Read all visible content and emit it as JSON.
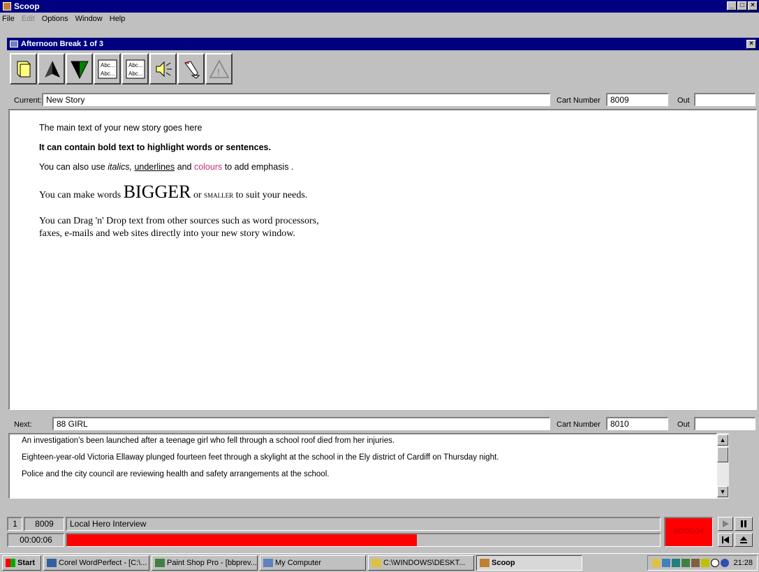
{
  "app": {
    "title": "Scoop",
    "icon": "scoop-app-icon"
  },
  "menu": [
    "File",
    "Edit",
    "Options",
    "Window",
    "Help"
  ],
  "child_window": {
    "title": "Afternoon Break 1 of 3"
  },
  "toolbar": {
    "buttons": [
      {
        "name": "open-book-icon"
      },
      {
        "name": "previous-story-icon"
      },
      {
        "name": "next-story-icon"
      },
      {
        "name": "text-style-icon",
        "text": [
          "Abc...",
          "Abc..."
        ]
      },
      {
        "name": "text-format-icon",
        "text": [
          "Abc...",
          "Abc..."
        ]
      },
      {
        "name": "speaker-icon"
      },
      {
        "name": "edit-pen-icon"
      },
      {
        "name": "warning-icon"
      }
    ]
  },
  "current": {
    "label": "Current:",
    "value": "New Story",
    "cart_label": "Cart Number",
    "cart_value": "8009",
    "out_label": "Out",
    "out_value": ""
  },
  "story": {
    "line1": "The main text of your new story goes here",
    "line2": "It can contain bold text to highlight words or sentences.",
    "line3_a": "You can also use ",
    "line3_italics": "italics,",
    "line3_b": " ",
    "line3_underline": "underlines",
    "line3_c": " and ",
    "line3_colours": "colours",
    "line3_d": " to add emphasis .",
    "line4_a": "You can make words ",
    "line4_big": "BIGGER",
    "line4_b": " or ",
    "line4_small": "SMALLER",
    "line4_c": " to suit your needs.",
    "line5": "You can Drag 'n' Drop text from other sources such as word processors,",
    "line6": "faxes, e-mails and web sites directly into your new story window.",
    "colour_accent": "#c03080"
  },
  "next": {
    "label": "Next:",
    "value": "88 GIRL",
    "cart_label": "Cart Number",
    "cart_value": "8010",
    "out_label": "Out",
    "out_value": ""
  },
  "next_story": [
    "An investigation's been launched after a teenage girl who fell through a school roof died from her injuries.",
    "Eighteen-year-old Victoria Ellaway plunged fourteen feet through a skylight at the school in the Ely district of Cardiff on Thursday night.",
    "Police and the city council are reviewing health and safety arrangements at the school."
  ],
  "player": {
    "number": "1",
    "cart": "8009",
    "title": "Local Hero Interview",
    "elapsed": "00:00:06",
    "remaining": "00:00:04",
    "progress": 0.59,
    "progress_color": "#ff0000",
    "remaining_bg": "#ff0000"
  },
  "taskbar": {
    "start": "Start",
    "tasks": [
      {
        "label": "Corel WordPerfect - [C:\\...",
        "icon": "wordperfect-icon",
        "active": false
      },
      {
        "label": "Paint Shop Pro - [bbprev...",
        "icon": "paintshop-icon",
        "active": false
      },
      {
        "label": "My Computer",
        "icon": "computer-icon",
        "active": false
      },
      {
        "label": "C:\\WINDOWS\\DESKT...",
        "icon": "folder-icon",
        "active": false
      },
      {
        "label": "Scoop",
        "icon": "scoop-task-icon",
        "active": true
      }
    ],
    "clock": "21:28"
  }
}
